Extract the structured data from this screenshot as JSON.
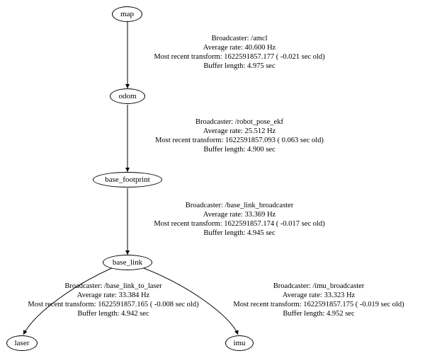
{
  "diagram": {
    "type": "tf_tree",
    "nodes": {
      "map": {
        "label": "map"
      },
      "odom": {
        "label": "odom"
      },
      "base_footprint": {
        "label": "base_footprint"
      },
      "base_link": {
        "label": "base_link"
      },
      "laser": {
        "label": "laser"
      },
      "imu": {
        "label": "imu"
      }
    },
    "edges": {
      "map_odom": {
        "from": "map",
        "to": "odom",
        "l1": "Broadcaster: /amcl",
        "l2": "Average rate: 40.600 Hz",
        "l3": "Most recent transform: 1622591857.177 ( -0.021 sec old)",
        "l4": "Buffer length: 4.975 sec"
      },
      "odom_basefootprint": {
        "from": "odom",
        "to": "base_footprint",
        "l1": "Broadcaster: /robot_pose_ekf",
        "l2": "Average rate: 25.512 Hz",
        "l3": "Most recent transform: 1622591857.093 ( 0.063 sec old)",
        "l4": "Buffer length: 4.900 sec"
      },
      "basefootprint_baselink": {
        "from": "base_footprint",
        "to": "base_link",
        "l1": "Broadcaster: /base_link_broadcaster",
        "l2": "Average rate: 33.369 Hz",
        "l3": "Most recent transform: 1622591857.174 ( -0.017 sec old)",
        "l4": "Buffer length: 4.945 sec"
      },
      "baselink_laser": {
        "from": "base_link",
        "to": "laser",
        "l1": "Broadcaster: /base_link_to_laser",
        "l2": "Average rate: 33.384 Hz",
        "l3": "Most recent transform: 1622591857.165 ( -0.008 sec old)",
        "l4": "Buffer length: 4.942 sec"
      },
      "baselink_imu": {
        "from": "base_link",
        "to": "imu",
        "l1": "Broadcaster: /imu_broadcaster",
        "l2": "Average rate: 33.323 Hz",
        "l3": "Most recent transform: 1622591857.175 ( -0.019 sec old)",
        "l4": "Buffer length: 4.952 sec"
      }
    }
  }
}
